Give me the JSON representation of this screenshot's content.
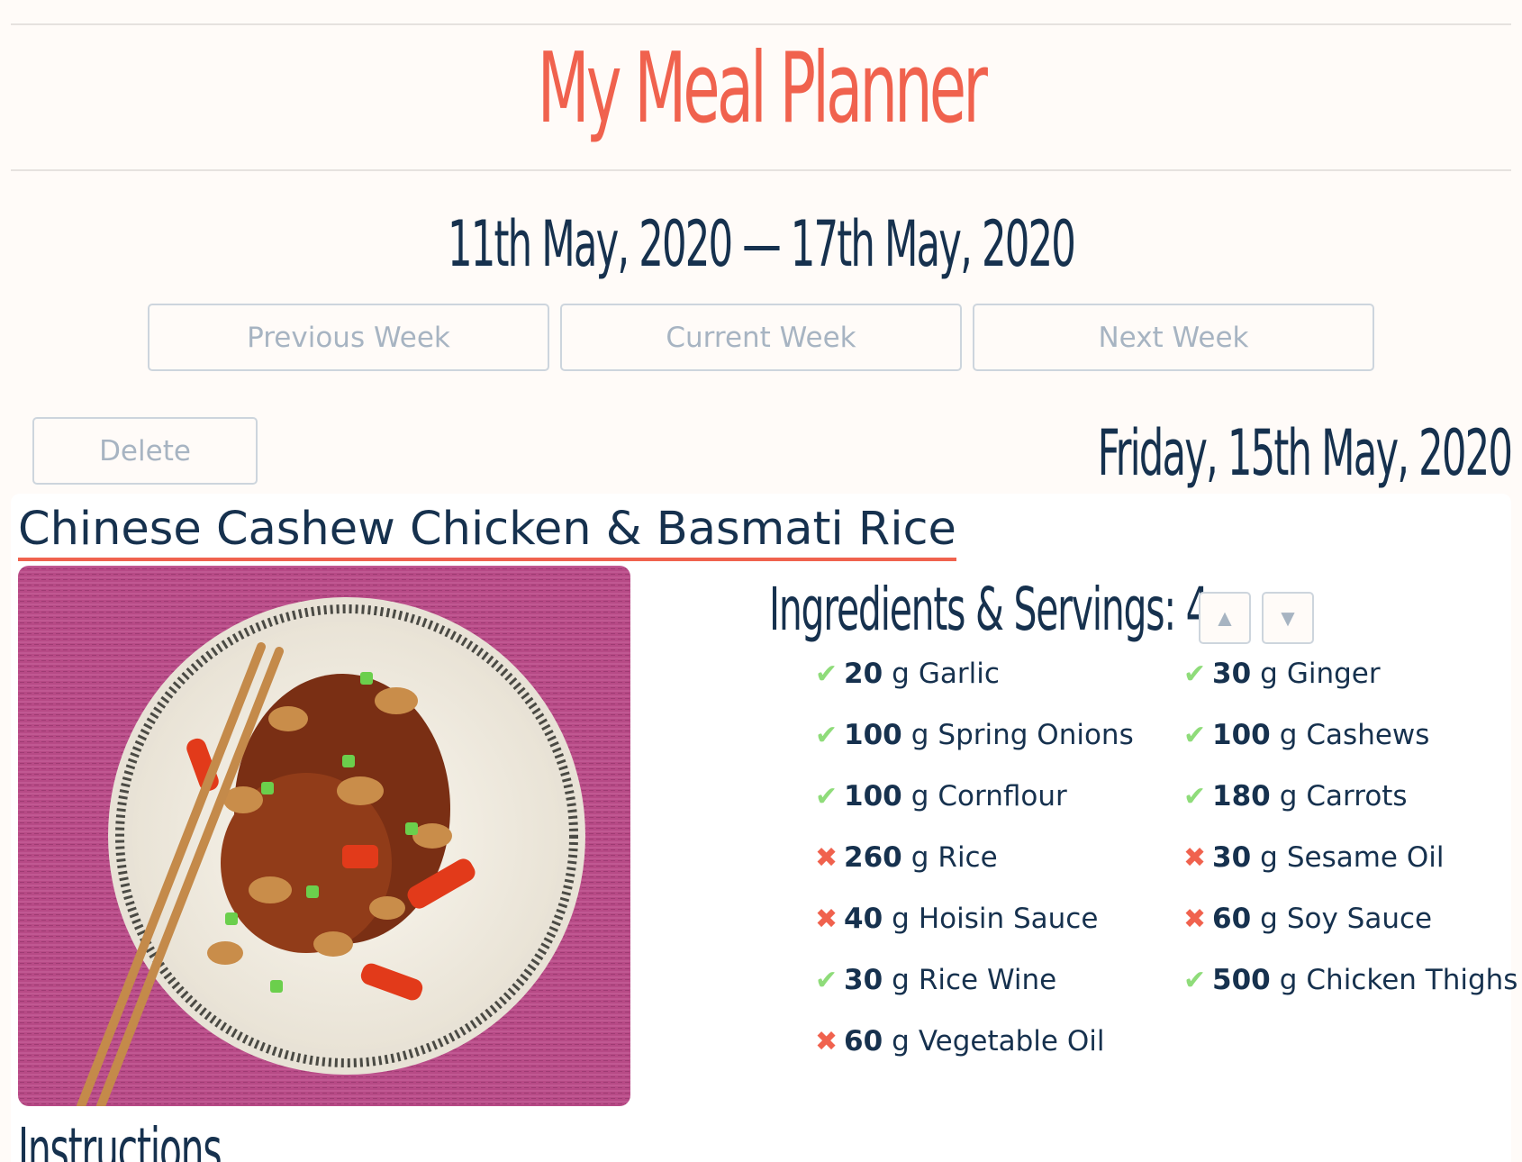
{
  "header": {
    "title": "My Meal Planner"
  },
  "week": {
    "range": "11th May, 2020 — 17th May, 2020",
    "prev_label": "Previous Week",
    "current_label": "Current Week",
    "next_label": "Next Week"
  },
  "day": {
    "delete_label": "Delete",
    "date": "Friday, 15th May, 2020"
  },
  "recipe": {
    "title": "Chinese Cashew Chicken & Basmati Rice",
    "image_icon": "food-photo-icon",
    "ingredients_heading": "Ingredients & Servings: 4",
    "servings_up": "▲",
    "servings_down": "▼",
    "ingredients": [
      {
        "qty": "20",
        "unit": "g",
        "name": "Garlic",
        "have": true
      },
      {
        "qty": "30",
        "unit": "g",
        "name": "Ginger",
        "have": true
      },
      {
        "qty": "100",
        "unit": "g",
        "name": "Spring Onions",
        "have": true
      },
      {
        "qty": "100",
        "unit": "g",
        "name": "Cashews",
        "have": true
      },
      {
        "qty": "100",
        "unit": "g",
        "name": "Cornflour",
        "have": true
      },
      {
        "qty": "180",
        "unit": "g",
        "name": "Carrots",
        "have": true
      },
      {
        "qty": "260",
        "unit": "g",
        "name": "Rice",
        "have": false
      },
      {
        "qty": "30",
        "unit": "g",
        "name": "Sesame Oil",
        "have": false
      },
      {
        "qty": "40",
        "unit": "g",
        "name": "Hoisin Sauce",
        "have": false
      },
      {
        "qty": "60",
        "unit": "g",
        "name": "Soy Sauce",
        "have": false
      },
      {
        "qty": "30",
        "unit": "g",
        "name": "Rice Wine",
        "have": true
      },
      {
        "qty": "500",
        "unit": "g",
        "name": "Chicken Thighs",
        "have": true
      },
      {
        "qty": "60",
        "unit": "g",
        "name": "Vegetable Oil",
        "have": false
      }
    ],
    "instructions_heading": "Instructions"
  },
  "marks": {
    "have": "✔",
    "missing": "✖"
  },
  "colors": {
    "accent": "#f0624e",
    "navy": "#16314e",
    "check": "#8fdc7a"
  }
}
